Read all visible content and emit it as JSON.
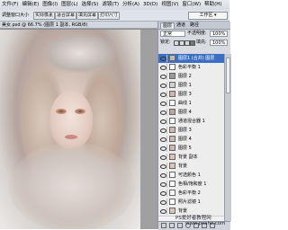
{
  "menu": [
    "文件(F)",
    "编辑(E)",
    "图像(I)",
    "图层(L)",
    "选择(S)",
    "滤镜(T)",
    "分析(A)",
    "3D(D)",
    "视图(V)",
    "窗口(W)",
    "帮助(H)"
  ],
  "options": {
    "label": "调整窗口大小",
    "buttons": [
      "实际像素",
      "适合屏幕",
      "填充屏幕",
      "打印尺寸"
    ],
    "workspace": "工作区 ▾"
  },
  "document": {
    "tab": "美女.psd @ 66.7% (图层 1 副本, RGB/8)",
    "watermark_1": "PS爱好者教程网",
    "watermark_2": "www.psahz.com"
  },
  "panel": {
    "tabs": [
      "图层",
      "通道",
      "路径"
    ],
    "blend_mode": "正常",
    "opacity_label": "不透明度:",
    "opacity": "100%",
    "lock_label": "锁定:",
    "fill_label": "填充:",
    "fill": "100%",
    "layers": [
      {
        "name": "图层1 (合并) 图层",
        "selected": true,
        "thumb": "#c8b8b0"
      },
      {
        "name": "色彩平衡 1",
        "selected": false,
        "thumb": "#ffffff"
      },
      {
        "name": "图层 2",
        "selected": false,
        "thumb": "#9a9a9a"
      },
      {
        "name": "图层 1",
        "selected": false,
        "thumb": "#d0d0d0"
      },
      {
        "name": "图层 3",
        "selected": false,
        "thumb": "#c9b6ac"
      },
      {
        "name": "曲线 1",
        "selected": false,
        "thumb": "#ffffff"
      },
      {
        "name": "图层 4",
        "selected": false,
        "thumb": "#b8a79f"
      },
      {
        "name": "通道混合器 1",
        "selected": false,
        "thumb": "#ffffff"
      },
      {
        "name": "图层 3",
        "selected": false,
        "thumb": "#cbbab2"
      },
      {
        "name": "图层 4",
        "selected": false,
        "thumb": "#cbbab2"
      },
      {
        "name": "图层 5",
        "selected": false,
        "thumb": "#cbbab2"
      },
      {
        "name": "背景 副本",
        "selected": false,
        "thumb": "#d6c6be"
      },
      {
        "name": "背景",
        "selected": false,
        "thumb": "#d6c6be"
      },
      {
        "name": "可选颜色 1",
        "selected": false,
        "thumb": "#ffffff"
      },
      {
        "name": "色相/饱和度 1",
        "selected": false,
        "thumb": "#ffffff"
      },
      {
        "name": "色彩平衡 2",
        "selected": false,
        "thumb": "#ffffff"
      },
      {
        "name": "照片滤镜 1",
        "selected": false,
        "thumb": "#ffffff"
      },
      {
        "name": "背景",
        "selected": false,
        "thumb": "#d6c6be"
      }
    ]
  }
}
